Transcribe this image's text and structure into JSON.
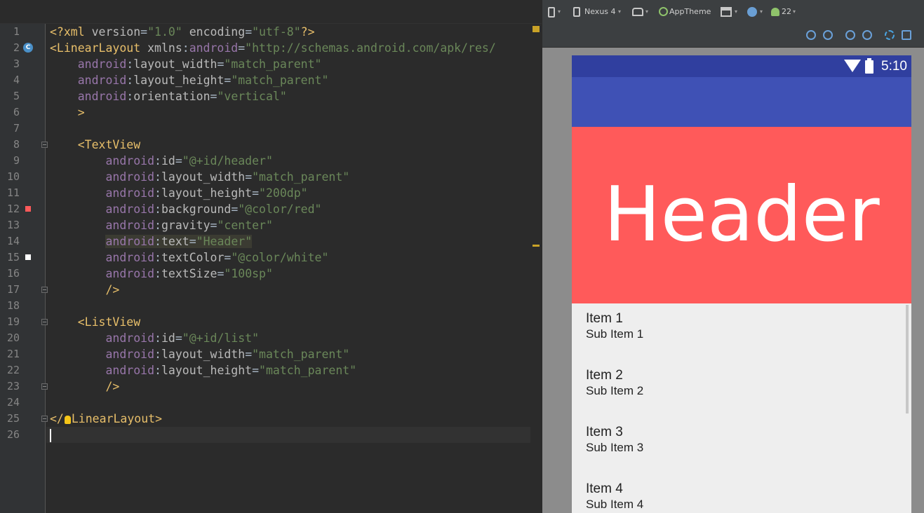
{
  "editor": {
    "lines": [
      {
        "num": "1",
        "tokens": [
          [
            "tag",
            "<?xml "
          ],
          [
            "attr",
            "version"
          ],
          [
            "plain",
            "="
          ],
          [
            "val",
            "\"1.0\""
          ],
          [
            "plain",
            " "
          ],
          [
            "attr",
            "encoding"
          ],
          [
            "plain",
            "="
          ],
          [
            "val",
            "\"utf-8\""
          ],
          [
            "tag",
            "?>"
          ]
        ]
      },
      {
        "num": "2",
        "badge": "C",
        "tokens": [
          [
            "tag",
            "<LinearLayout "
          ],
          [
            "attr",
            "xmlns"
          ],
          [
            "plain",
            ":"
          ],
          [
            "ns",
            "android"
          ],
          [
            "plain",
            "="
          ],
          [
            "val",
            "\"http://schemas.android.com/apk/res/"
          ]
        ]
      },
      {
        "num": "3",
        "tokens": [
          [
            "plain",
            "    "
          ],
          [
            "ns",
            "android"
          ],
          [
            "plain",
            ":"
          ],
          [
            "attr",
            "layout_width"
          ],
          [
            "plain",
            "="
          ],
          [
            "val",
            "\"match_parent\""
          ]
        ]
      },
      {
        "num": "4",
        "tokens": [
          [
            "plain",
            "    "
          ],
          [
            "ns",
            "android"
          ],
          [
            "plain",
            ":"
          ],
          [
            "attr",
            "layout_height"
          ],
          [
            "plain",
            "="
          ],
          [
            "val",
            "\"match_parent\""
          ]
        ]
      },
      {
        "num": "5",
        "tokens": [
          [
            "plain",
            "    "
          ],
          [
            "ns",
            "android"
          ],
          [
            "plain",
            ":"
          ],
          [
            "attr",
            "orientation"
          ],
          [
            "plain",
            "="
          ],
          [
            "val",
            "\"vertical\""
          ]
        ]
      },
      {
        "num": "6",
        "tokens": [
          [
            "plain",
            "    "
          ],
          [
            "tag",
            ">"
          ]
        ]
      },
      {
        "num": "7",
        "tokens": []
      },
      {
        "num": "8",
        "fold": true,
        "tokens": [
          [
            "plain",
            "    "
          ],
          [
            "tag",
            "<TextView"
          ]
        ]
      },
      {
        "num": "9",
        "tokens": [
          [
            "plain",
            "        "
          ],
          [
            "ns",
            "android"
          ],
          [
            "plain",
            ":"
          ],
          [
            "attr",
            "id"
          ],
          [
            "plain",
            "="
          ],
          [
            "val",
            "\"@+id/header\""
          ]
        ]
      },
      {
        "num": "10",
        "tokens": [
          [
            "plain",
            "        "
          ],
          [
            "ns",
            "android"
          ],
          [
            "plain",
            ":"
          ],
          [
            "attr",
            "layout_width"
          ],
          [
            "plain",
            "="
          ],
          [
            "val",
            "\"match_parent\""
          ]
        ]
      },
      {
        "num": "11",
        "tokens": [
          [
            "plain",
            "        "
          ],
          [
            "ns",
            "android"
          ],
          [
            "plain",
            ":"
          ],
          [
            "attr",
            "layout_height"
          ],
          [
            "plain",
            "="
          ],
          [
            "val",
            "\"200dp\""
          ]
        ]
      },
      {
        "num": "12",
        "swatch": "#ff5a5a",
        "tokens": [
          [
            "plain",
            "        "
          ],
          [
            "ns",
            "android"
          ],
          [
            "plain",
            ":"
          ],
          [
            "attr",
            "background"
          ],
          [
            "plain",
            "="
          ],
          [
            "val",
            "\"@color/red\""
          ]
        ]
      },
      {
        "num": "13",
        "tokens": [
          [
            "plain",
            "        "
          ],
          [
            "ns",
            "android"
          ],
          [
            "plain",
            ":"
          ],
          [
            "attr",
            "gravity"
          ],
          [
            "plain",
            "="
          ],
          [
            "val",
            "\"center\""
          ]
        ]
      },
      {
        "num": "14",
        "tokens": [
          [
            "plain",
            "        "
          ],
          [
            "ns-hl",
            "android"
          ],
          [
            "plain-hl",
            ":"
          ],
          [
            "attr-hl",
            "text"
          ],
          [
            "plain-hl",
            "="
          ],
          [
            "val-hl",
            "\"Header\""
          ]
        ]
      },
      {
        "num": "15",
        "swatch": "#ffffff",
        "tokens": [
          [
            "plain",
            "        "
          ],
          [
            "ns",
            "android"
          ],
          [
            "plain",
            ":"
          ],
          [
            "attr",
            "textColor"
          ],
          [
            "plain",
            "="
          ],
          [
            "val",
            "\"@color/white\""
          ]
        ]
      },
      {
        "num": "16",
        "tokens": [
          [
            "plain",
            "        "
          ],
          [
            "ns",
            "android"
          ],
          [
            "plain",
            ":"
          ],
          [
            "attr",
            "textSize"
          ],
          [
            "plain",
            "="
          ],
          [
            "val",
            "\"100sp\""
          ]
        ]
      },
      {
        "num": "17",
        "fold": true,
        "tokens": [
          [
            "plain",
            "        "
          ],
          [
            "tag",
            "/>"
          ]
        ]
      },
      {
        "num": "18",
        "tokens": []
      },
      {
        "num": "19",
        "fold": true,
        "tokens": [
          [
            "plain",
            "    "
          ],
          [
            "tag",
            "<ListView"
          ]
        ]
      },
      {
        "num": "20",
        "tokens": [
          [
            "plain",
            "        "
          ],
          [
            "ns",
            "android"
          ],
          [
            "plain",
            ":"
          ],
          [
            "attr",
            "id"
          ],
          [
            "plain",
            "="
          ],
          [
            "val",
            "\"@+id/list\""
          ]
        ]
      },
      {
        "num": "21",
        "tokens": [
          [
            "plain",
            "        "
          ],
          [
            "ns",
            "android"
          ],
          [
            "plain",
            ":"
          ],
          [
            "attr",
            "layout_width"
          ],
          [
            "plain",
            "="
          ],
          [
            "val",
            "\"match_parent\""
          ]
        ]
      },
      {
        "num": "22",
        "tokens": [
          [
            "plain",
            "        "
          ],
          [
            "ns",
            "android"
          ],
          [
            "plain",
            ":"
          ],
          [
            "attr",
            "layout_height"
          ],
          [
            "plain",
            "="
          ],
          [
            "val",
            "\"match_parent\""
          ]
        ]
      },
      {
        "num": "23",
        "fold": true,
        "tokens": [
          [
            "plain",
            "        "
          ],
          [
            "tag",
            "/>"
          ]
        ]
      },
      {
        "num": "24",
        "tokens": []
      },
      {
        "num": "25",
        "fold": true,
        "bulb": true,
        "tokens": [
          [
            "tag",
            "</"
          ],
          [
            "bulb",
            ""
          ],
          [
            "tag",
            "LinearLayout>"
          ]
        ]
      },
      {
        "num": "26",
        "current": true,
        "caret": true,
        "tokens": []
      }
    ],
    "stripe_colors": [
      "#c9a227",
      "#c9a227"
    ]
  },
  "toolbar": {
    "device_label": "Nexus 4",
    "theme_label": "AppTheme",
    "api_label": "22"
  },
  "device": {
    "status_time": "5:10",
    "header_text": "Header",
    "list_items": [
      {
        "title": "Item 1",
        "sub": "Sub Item 1"
      },
      {
        "title": "Item 2",
        "sub": "Sub Item 2"
      },
      {
        "title": "Item 3",
        "sub": "Sub Item 3"
      },
      {
        "title": "Item 4",
        "sub": "Sub Item 4"
      }
    ]
  },
  "colors": {
    "status_bar": "#303f9f",
    "action_bar": "#3f51b5",
    "header_bg": "#ff5a5a",
    "list_bg": "#eeeeee"
  }
}
